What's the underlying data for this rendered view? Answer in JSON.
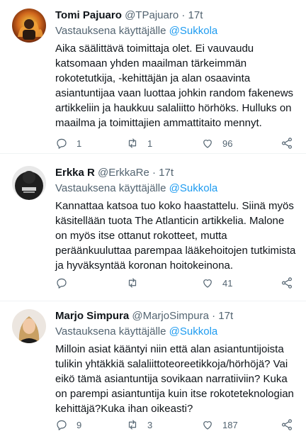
{
  "colors": {
    "accent": "#1d9bf0",
    "secondary": "#536471",
    "text": "#0f1419"
  },
  "tweets": [
    {
      "name": "Tomi Pajuaro",
      "handle": "@TPajuaro",
      "dot": "·",
      "time": "17t",
      "reply_prefix": "Vastauksena käyttäjälle",
      "reply_to": "@Sukkola",
      "text": "Aika säälittävä toimittaja olet. Ei vauvaudu katsomaan yhden maailman tärkeimmän rokotetutkija, -kehittäjän ja alan osaavinta asiantuntijaa vaan luottaa johkin random fakenews artikkeliin ja haukkuu salaliitto hörhöks. Hulluks on maailma ja toimittajien ammattitaito mennyt.",
      "replies": "1",
      "retweets": "1",
      "likes": "96",
      "avatar_icon": "avatar-flames"
    },
    {
      "name": "Erkka R",
      "handle": "@ErkkaRe",
      "dot": "·",
      "time": "17t",
      "reply_prefix": "Vastauksena käyttäjälle",
      "reply_to": "@Sukkola",
      "text": "Kannattaa katsoa tuo koko haastattelu. Siinä myös käsitellään tuota The Atlanticin artikkelia. Malone on myös itse ottanut rokotteet, mutta peräänkuuluttaa parempaa lääkehoitojen tutkimista ja hyväksyntää koronan hoitokeinona.",
      "replies": "",
      "retweets": "",
      "likes": "41",
      "avatar_icon": "avatar-dark"
    },
    {
      "name": "Marjo Simpura",
      "handle": "@MarjoSimpura",
      "dot": "·",
      "time": "17t",
      "reply_prefix": "Vastauksena käyttäjälle",
      "reply_to": "@Sukkola",
      "text": "Milloin asiat kääntyi niin että alan  asiantuntijoista tulikin yhtäkkiä salaliittoteoreetikkoja/hörhöjä? Vai eikö tämä asiantuntija sovikaan narratiiviin? Kuka on parempi asiantuntija kuin itse rokoteteknologian kehittäjä?Kuka ihan oikeasti?",
      "replies": "9",
      "retweets": "3",
      "likes": "187",
      "avatar_icon": "avatar-portrait"
    }
  ]
}
